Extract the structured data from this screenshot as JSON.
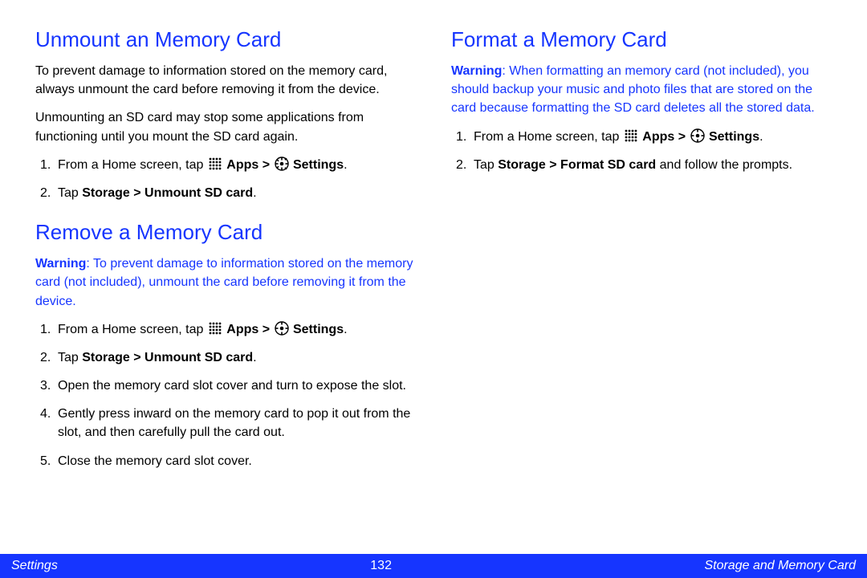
{
  "sections": {
    "unmount": {
      "title": "Unmount an Memory Card",
      "para1": "To prevent damage to information stored on the memory card, always unmount the card before removing it from the device.",
      "para2": "Unmounting an SD card may stop some applications from functioning until you mount the SD card again.",
      "steps": {
        "s1_pre": "From a Home screen, tap ",
        "s1_apps": "Apps > ",
        "s1_settings": "Settings",
        "s2_pre": "Tap ",
        "s2_bold": "Storage > Unmount SD card",
        "s2_post": "."
      }
    },
    "remove": {
      "title": "Remove a Memory Card",
      "warning_label": "Warning",
      "warning_body": ": To prevent damage to information stored on the memory card (not included), unmount the card before removing it from the device.",
      "steps": {
        "s1_pre": "From a Home screen, tap ",
        "s1_apps": "Apps > ",
        "s1_settings": "Settings",
        "s2_pre": "Tap ",
        "s2_bold": "Storage > Unmount SD card",
        "s2_post": ".",
        "s3": "Open the memory card slot cover and turn to expose the slot.",
        "s4": "Gently press inward on the memory card to pop it out from the slot, and then carefully pull the card out.",
        "s5": "Close the memory card slot cover."
      }
    },
    "format": {
      "title": "Format a Memory Card",
      "warning_label": "Warning",
      "warning_body": ": When formatting an memory card (not included), you should backup your music and photo files that are stored on the card because formatting the SD card deletes all the stored data.",
      "steps": {
        "s1_pre": "From a Home screen, tap ",
        "s1_apps": "Apps > ",
        "s1_settings": "Settings",
        "s2_pre": "Tap ",
        "s2_bold": "Storage > Format SD card",
        "s2_post": " and follow the prompts."
      }
    }
  },
  "numbers": {
    "n1": "1.",
    "n2": "2.",
    "n3": "3.",
    "n4": "4.",
    "n5": "5."
  },
  "punct": {
    "period": "."
  },
  "footer": {
    "left": "Settings",
    "center": "132",
    "right": "Storage and Memory Card"
  },
  "icons": {
    "apps": "apps-grid-icon",
    "settings": "settings-gear-icon"
  }
}
